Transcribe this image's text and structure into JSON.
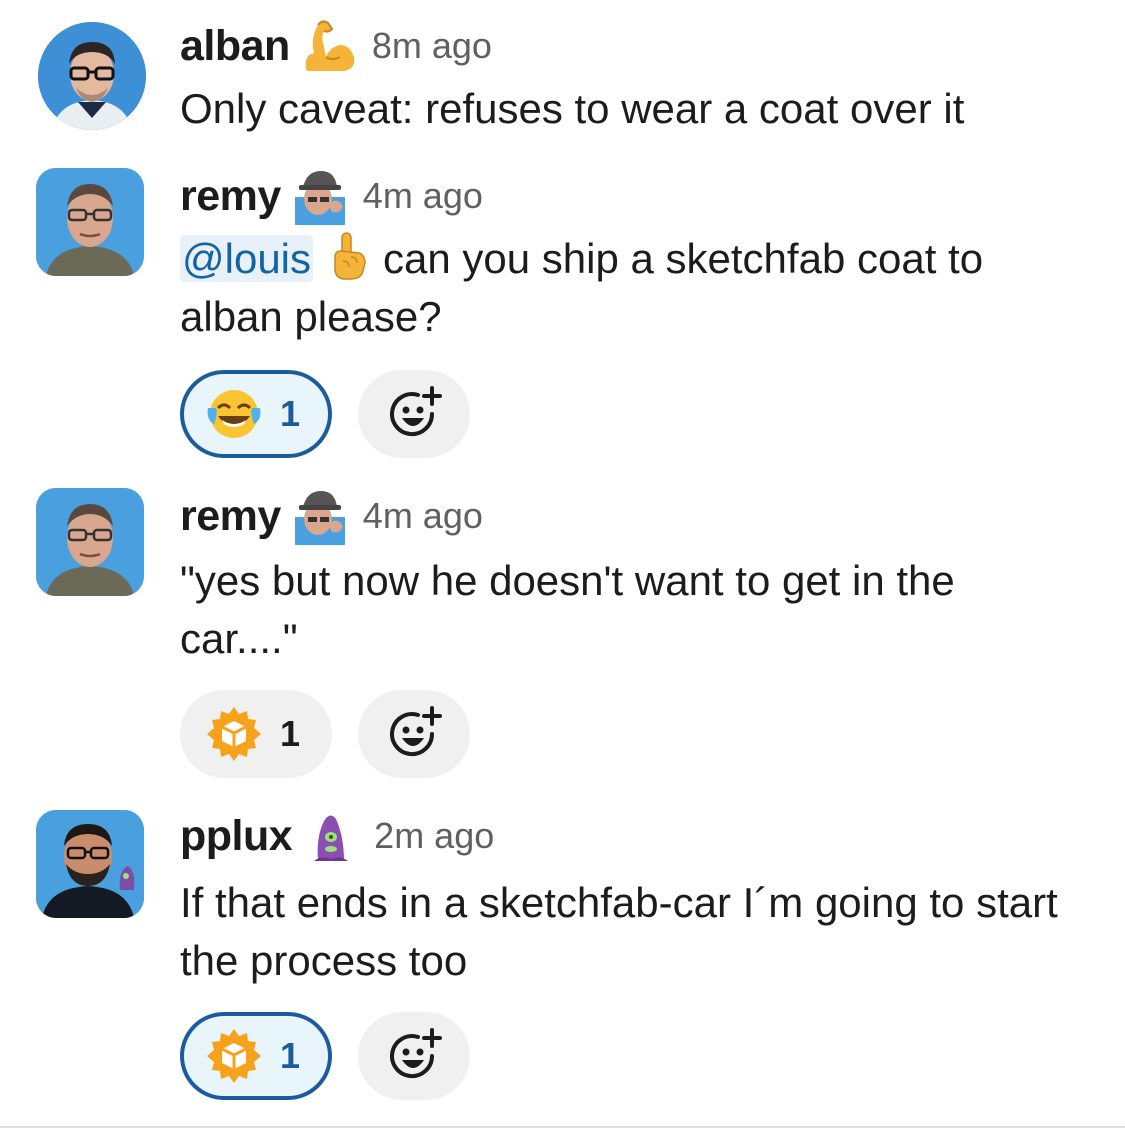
{
  "messages": [
    {
      "author": "alban",
      "status_emoji": "flexed-biceps",
      "time": "8m ago",
      "text": "Only caveat: refuses to wear a coat over it"
    },
    {
      "author": "remy",
      "status_emoji": "custom-face",
      "time": "4m ago",
      "mention": "@louis",
      "inline_emoji": "point-up",
      "text": "can you ship a sketchfab coat to alban please?",
      "reaction": {
        "emoji": "joy",
        "count": "1",
        "active": true
      }
    },
    {
      "author": "remy",
      "status_emoji": "custom-face",
      "time": "4m ago",
      "text": "\"yes but now he doesn't want to get in the car....\"",
      "reaction": {
        "emoji": "sketchfab-logo",
        "count": "1",
        "active": false
      }
    },
    {
      "author": "pplux",
      "status_emoji": "purple-tentacle",
      "time": "2m ago",
      "text": "If that ends in a sketchfab-car I´m going to start the process too",
      "reaction": {
        "emoji": "sketchfab-logo",
        "count": "1",
        "active": true
      }
    }
  ],
  "add_reaction_icon": "add-reaction-icon",
  "colors": {
    "accent": "#1d5c9c",
    "mention_bg": "#e8f1fa",
    "mention_text": "#1264a3",
    "timestamp": "#616061",
    "sketchfab_orange": "#f7a21b"
  }
}
